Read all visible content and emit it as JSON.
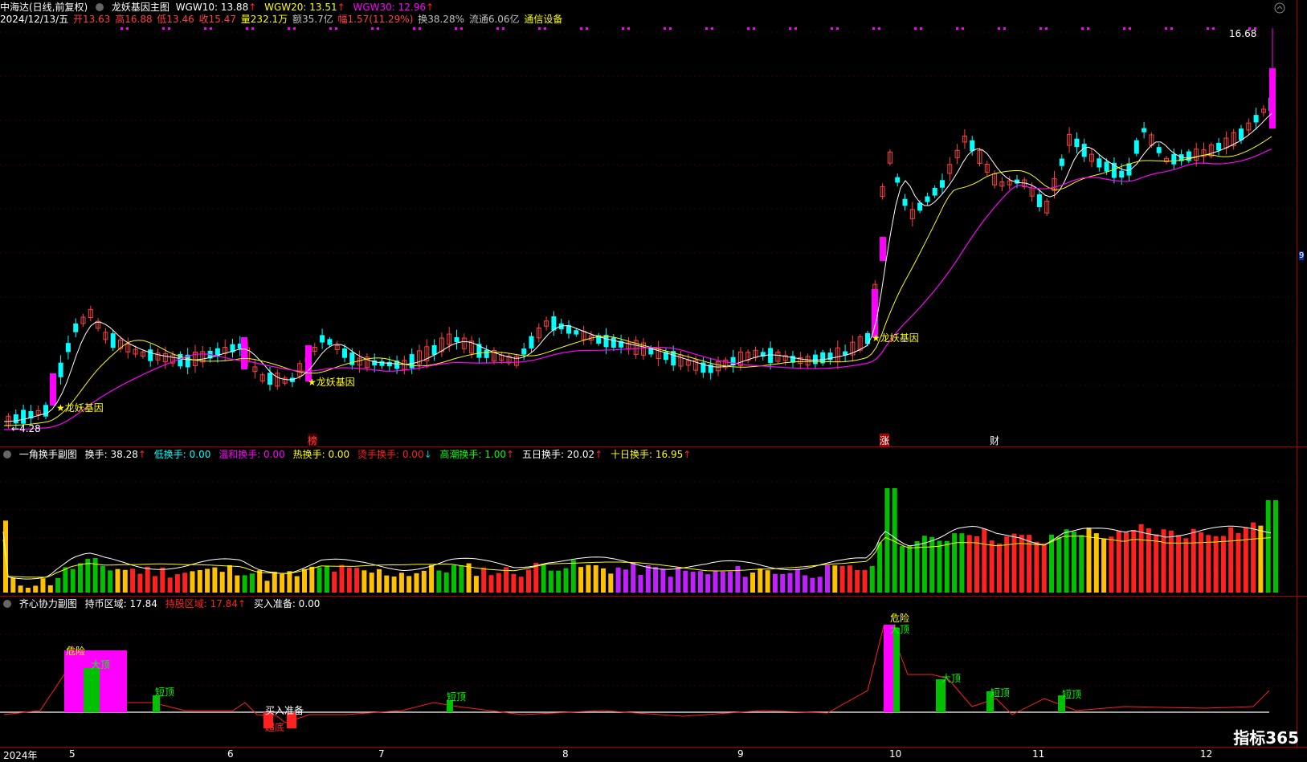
{
  "header": {
    "stock_name": "中海达(日线,前复权)",
    "indicator": "龙妖基因主图",
    "wgw10": "WGW10: 13.88",
    "wgw20": "WGW20: 13.51",
    "wgw30": "WGW30: 12.96",
    "date": "2024/12/13/五",
    "open": "开13.63",
    "high": "高16.88",
    "low": "低13.46",
    "close": "收15.47",
    "volume": "量232.1万",
    "amount": "额35.7亿",
    "change": "幅1.57(11.29%)",
    "turnover": "换38.28%",
    "float": "流通6.06亿",
    "sector": "通信设备"
  },
  "main_chart": {
    "max_label": "16.68",
    "min_label": "4.28",
    "signal_label": "龙妖基因",
    "event_markers": [
      "榜",
      "涨",
      "财"
    ],
    "right_tag": "9"
  },
  "sub1": {
    "title": "一角换手副图",
    "turnover": "换手: 38.28",
    "low": "低换手: 0.00",
    "mild": "温和换手: 0.00",
    "hot": "热换手: 0.00",
    "scorching": "烫手换手: 0.00",
    "peak": "高潮换手: 1.00",
    "five_day": "五日换手: 20.02",
    "ten_day": "十日换手: 16.95"
  },
  "sub2": {
    "title": "齐心协力副图",
    "hold_coin": "持币区域: 17.84",
    "hold_stock": "持股区域: 17.84",
    "buy_ready": "买入准备: 0.00",
    "labels": {
      "danger": "危险",
      "top_big": "大顶",
      "top_short": "短顶",
      "buy_ready": "买入准备",
      "bottom": "超底"
    }
  },
  "time_axis": {
    "labels": [
      "2024年",
      "5",
      "6",
      "7",
      "8",
      "9",
      "10",
      "11",
      "12"
    ]
  },
  "watermark": "指标365",
  "colors": {
    "up_candle": "#ff00ff",
    "down_candle": "#00ffff",
    "ma_fast": "#ffffff",
    "ma_mid": "#ffff00",
    "ma_slow": "#ff00ff",
    "bar_green": "#00c000",
    "bar_red": "#ff2020",
    "bar_orange": "#ffc000",
    "bar_magenta": "#c020ff"
  }
}
